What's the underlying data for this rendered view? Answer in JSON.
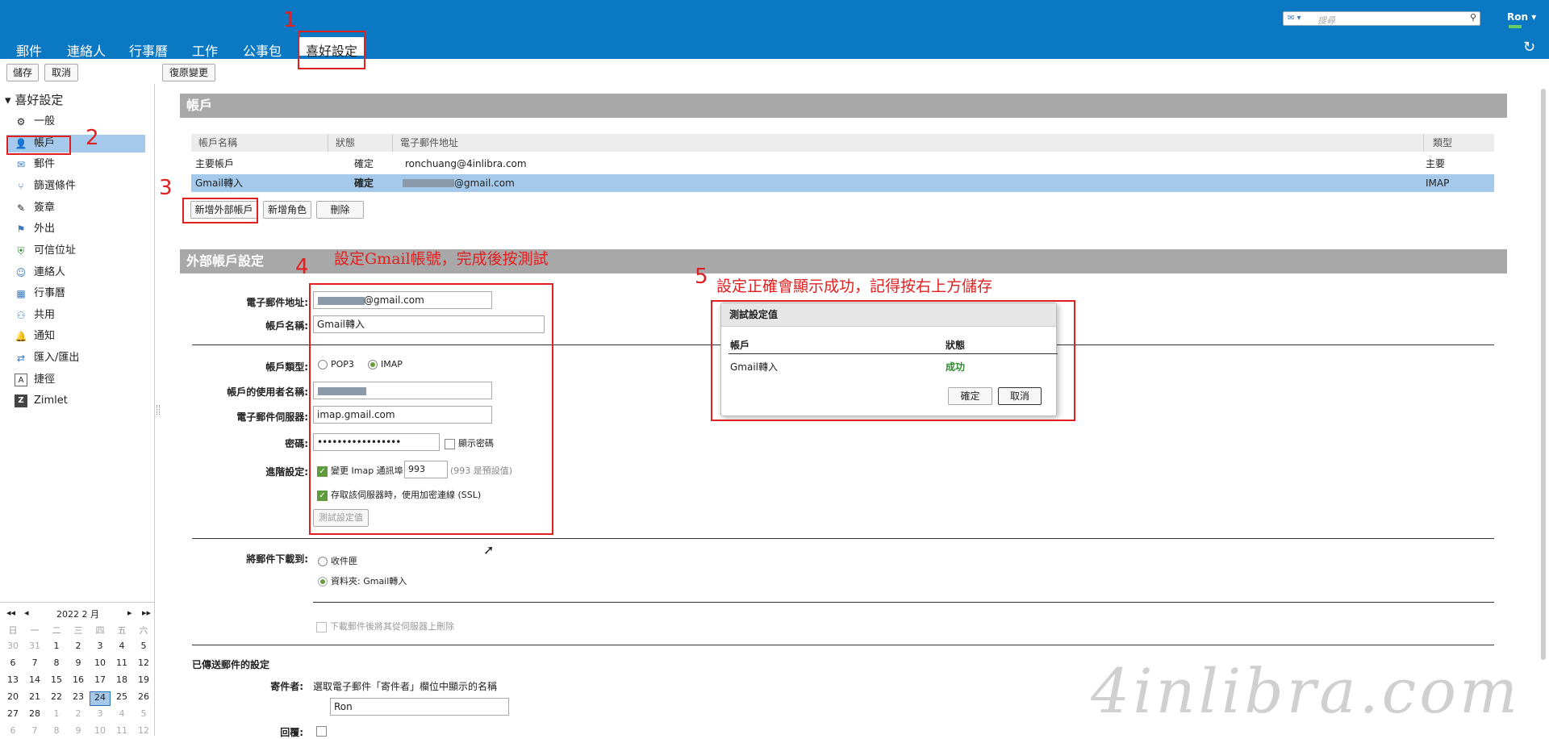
{
  "nav_tabs": [
    "郵件",
    "連絡人",
    "行事曆",
    "工作",
    "公事包",
    "喜好設定"
  ],
  "search": {
    "placeholder": "搜尋"
  },
  "user": "Ron",
  "toolbar": {
    "save": "儲存",
    "cancel": "取消",
    "revert": "復原變更"
  },
  "sidebar": {
    "title": "喜好設定",
    "items": [
      {
        "label": "一般",
        "icon": "gear-icon"
      },
      {
        "label": "帳戶",
        "icon": "account-icon"
      },
      {
        "label": "郵件",
        "icon": "mail-icon"
      },
      {
        "label": "篩選條件",
        "icon": "filter-icon"
      },
      {
        "label": "簽章",
        "icon": "signature-icon"
      },
      {
        "label": "外出",
        "icon": "out-of-office-icon"
      },
      {
        "label": "可信位址",
        "icon": "shield-icon"
      },
      {
        "label": "連絡人",
        "icon": "contacts-icon"
      },
      {
        "label": "行事曆",
        "icon": "calendar-icon"
      },
      {
        "label": "共用",
        "icon": "sharing-icon"
      },
      {
        "label": "通知",
        "icon": "bell-icon"
      },
      {
        "label": "匯入/匯出",
        "icon": "import-export-icon"
      },
      {
        "label": "捷徑",
        "icon": "shortcut-icon"
      },
      {
        "label": "Zimlet",
        "icon": "zimlet-icon"
      }
    ]
  },
  "calendar": {
    "month": "2022 2 月",
    "weekdays": [
      "日",
      "一",
      "二",
      "三",
      "四",
      "五",
      "六"
    ],
    "weeks": [
      [
        "30",
        "31",
        "1",
        "2",
        "3",
        "4",
        "5"
      ],
      [
        "6",
        "7",
        "8",
        "9",
        "10",
        "11",
        "12"
      ],
      [
        "13",
        "14",
        "15",
        "16",
        "17",
        "18",
        "19"
      ],
      [
        "20",
        "21",
        "22",
        "23",
        "24",
        "25",
        "26"
      ],
      [
        "27",
        "28",
        "1",
        "2",
        "3",
        "4",
        "5"
      ],
      [
        "6",
        "7",
        "8",
        "9",
        "10",
        "11",
        "12"
      ]
    ],
    "today": "24"
  },
  "accounts": {
    "header": "帳戶",
    "columns": [
      "帳戶名稱",
      "狀態",
      "電子郵件地址",
      "類型"
    ],
    "rows": [
      {
        "name": "主要帳戶",
        "status": "確定",
        "email": "ronchuang@4inlibra.com",
        "type": "主要"
      },
      {
        "name": "Gmail轉入",
        "status": "確定",
        "email": "@gmail.com",
        "type": "IMAP"
      }
    ],
    "buttons": {
      "add_external": "新增外部帳戶",
      "add_persona": "新增角色",
      "delete": "刪除"
    }
  },
  "external": {
    "header": "外部帳戶設定",
    "email_label": "電子郵件地址:",
    "email_value": "@gmail.com",
    "account_name_label": "帳戶名稱:",
    "account_name_value": "Gmail轉入",
    "type_label": "帳戶類型:",
    "type_pop3": "POP3",
    "type_imap": "IMAP",
    "username_label": "帳戶的使用者名稱:",
    "server_label": "電子郵件伺服器:",
    "server_value": "imap.gmail.com",
    "password_label": "密碼:",
    "password_value": "•••••••••••••••••",
    "show_password": "顯示密碼",
    "advanced_label": "進階設定:",
    "port_change": "變更 Imap 通訊埠",
    "port_value": "993",
    "port_default": "(993 是預設值)",
    "ssl": "存取該伺服器時，使用加密連線 (SSL)",
    "test_button": "測試設定值",
    "download_label": "將郵件下載到:",
    "inbox": "收件匣",
    "folder": "資料夾: Gmail轉入",
    "delete_after": "下載郵件後將其從伺服器上刪除",
    "sent_settings": "已傳送郵件的設定",
    "from_label": "寄件者:",
    "from_desc": "選取電子郵件「寄件者」欄位中顯示的名稱",
    "from_value": "Ron",
    "reply_label": "回覆:"
  },
  "dialog": {
    "title": "測試設定值",
    "col_account": "帳戶",
    "col_status": "狀態",
    "row_account": "Gmail轉入",
    "row_status": "成功",
    "ok": "確定",
    "cancel": "取消"
  },
  "annotations": {
    "n1": "1",
    "n2": "2",
    "n3": "3",
    "n4": "4",
    "n5": "5",
    "note4": "設定Gmail帳號，完成後按測試",
    "note5": "設定正確會顯示成功，記得按右上方儲存"
  },
  "watermark": "4inlibra.com",
  "colors": {
    "topbar": "#0a78c2",
    "selected": "#a4c9ea",
    "section": "#a8a8a8",
    "annotation": "#e02020",
    "success": "#2e8b2e"
  }
}
